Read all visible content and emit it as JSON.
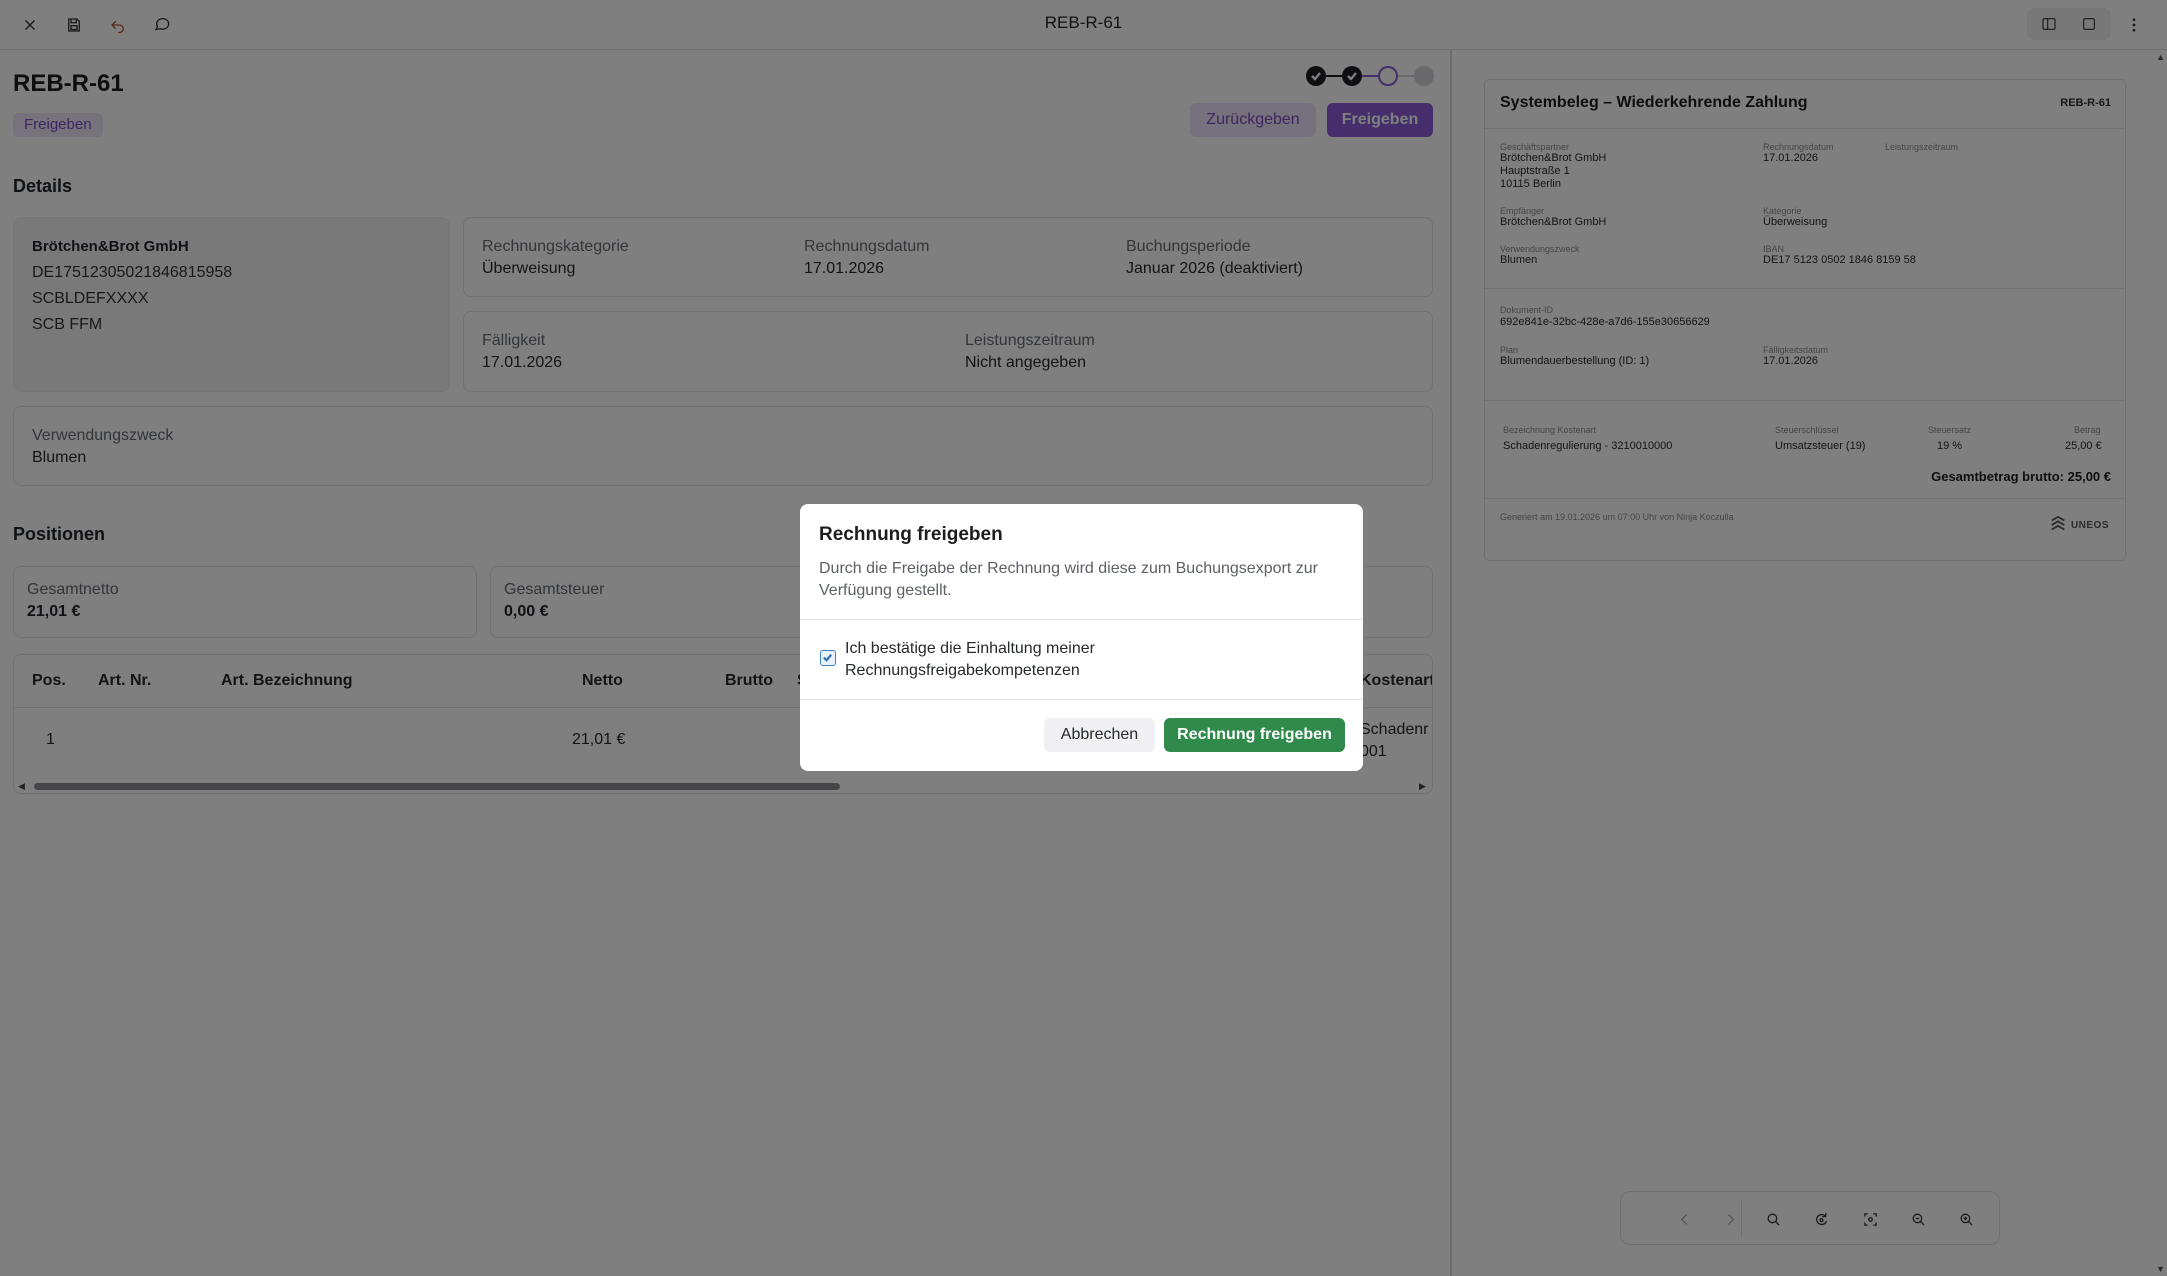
{
  "window": {
    "title": "REB-R-61"
  },
  "topbar": {
    "icons": [
      "close-icon",
      "save-icon",
      "undo-icon",
      "comment-icon",
      "split-layout-icon",
      "single-layout-icon",
      "more-vertical-icon"
    ]
  },
  "document": {
    "title": "REB-R-61",
    "status": "Freigeben",
    "steps": [
      "done",
      "done",
      "current",
      "todo"
    ],
    "actions": {
      "return_label": "Zurückgeben",
      "approve_label": "Freigeben"
    }
  },
  "details": {
    "section_title": "Details",
    "partner": {
      "name": "Brötchen&Brot GmbH",
      "iban": "DE17512305021846815958",
      "bic": "SCBLDEFXXXX",
      "bank": "SCB FFM"
    },
    "fields_row1": [
      {
        "label": "Rechnungskategorie",
        "value": "Überweisung"
      },
      {
        "label": "Rechnungsdatum",
        "value": "17.01.2026"
      },
      {
        "label": "Buchungsperiode",
        "value": "Januar 2026 (deaktiviert)"
      }
    ],
    "fields_row2": [
      {
        "label": "Fälligkeit",
        "value": "17.01.2026"
      },
      {
        "label": "Leistungszeitraum",
        "value": "Nicht angegeben"
      }
    ],
    "purpose": {
      "label": "Verwendungszweck",
      "value": "Blumen"
    }
  },
  "positions": {
    "section_title": "Positionen",
    "summary": [
      {
        "label": "Gesamtnetto",
        "value": "21,01 €"
      },
      {
        "label": "Gesamtsteuer",
        "value": "0,00 €"
      }
    ],
    "columns": [
      "Pos.",
      "Art. Nr.",
      "Art. Bezeichnung",
      "Netto",
      "Brutto",
      "S",
      "Kostenart"
    ],
    "rows": [
      {
        "pos": "1",
        "art_nr": "",
        "bezeichnung": "",
        "netto": "21,01 €",
        "brutto": "",
        "kostenart_line1": "Schadenr",
        "kostenart_line2": "001"
      }
    ]
  },
  "receipt": {
    "title": "Systembeleg – Wiederkehrende Zahlung",
    "id": "REB-R-61",
    "partner_label": "Geschäftspartner",
    "partner_lines": [
      "Brötchen&Brot GmbH",
      "Hauptstraße 1",
      "10115 Berlin"
    ],
    "invoice_date_label": "Rechnungsdatum",
    "invoice_date": "17.01.2026",
    "service_period_label": "Leistungszeitraum",
    "recipient_label": "Empfänger",
    "recipient": "Brötchen&Brot GmbH",
    "category_label": "Kategorie",
    "category": "Überweisung",
    "purpose_label": "Verwendungszweck",
    "purpose": "Blumen",
    "iban_label": "IBAN",
    "iban": "DE17 5123 0502 1846 8159 58",
    "document_id_label": "Dokument-ID",
    "document_id": "692e841e-32bc-428e-a7d6-155e30656629",
    "plan_label": "Plan",
    "plan": "Blumendauerbestellung (ID: 1)",
    "due_date_label": "Fälligkeitsdatum",
    "due_date": "17.01.2026",
    "table_headers": [
      "Bezeichnung Kostenart",
      "Steuerschlüssel",
      "Steuersatz",
      "Betrag"
    ],
    "table_row": [
      "Schadenregulierung - 3210010000",
      "Umsatzsteuer (19)",
      "19 %",
      "25,00 €"
    ],
    "total": "Gesamtbetrag brutto: 25,00 €",
    "footer": "Generiert am 19.01.2026 um 07:00 Uhr von Ninja Koczulla",
    "logo_text": "UNEOS"
  },
  "viewer_toolbar": {
    "icons": [
      "previous-icon",
      "next-icon",
      "search-icon",
      "rotate-icon",
      "fit-screen-icon",
      "zoom-out-icon",
      "zoom-in-icon"
    ]
  },
  "modal": {
    "title": "Rechnung freigeben",
    "description": "Durch die Freigabe der Rechnung wird diese zum Buchungsexport zur Verfügung gestellt.",
    "checkbox_label": "Ich bestätige die Einhaltung meiner Rechnungsfreigabekompetenzen",
    "checkbox_checked": true,
    "cancel_label": "Abbrechen",
    "confirm_label": "Rechnung freigeben"
  },
  "colors": {
    "accent": "#8a5cd6",
    "confirm": "#2f8a4c",
    "overlay": "rgba(0,0,0,0.5)"
  }
}
